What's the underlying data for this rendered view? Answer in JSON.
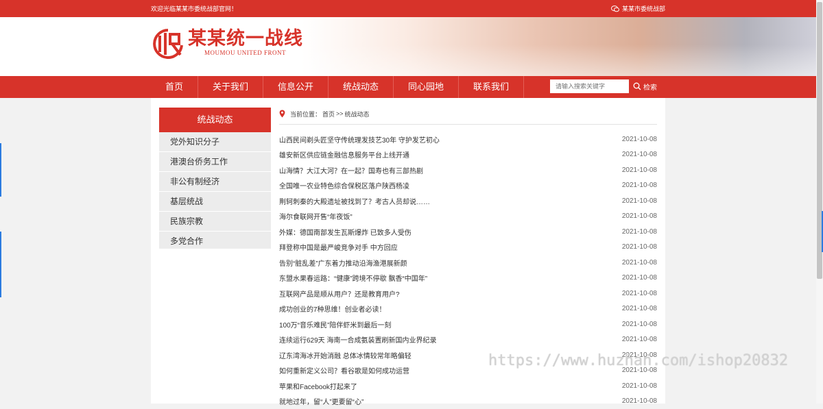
{
  "topbar": {
    "welcome": "欢迎光临某某市委统战部官网！",
    "site_name": "某某市委统战部"
  },
  "logo": {
    "title": "某某统一战线",
    "subtitle": "MOUMOU UNITED FRONT"
  },
  "nav": {
    "items": [
      "首页",
      "关于我们",
      "信息公开",
      "统战动态",
      "同心园地",
      "联系我们"
    ],
    "search_placeholder": "请输入搜索关键字",
    "search_label": "检索"
  },
  "sidebar": {
    "title": "统战动态",
    "items": [
      "党外知识分子",
      "港澳台侨务工作",
      "非公有制经济",
      "基层统战",
      "民族宗教",
      "多党合作"
    ]
  },
  "breadcrumb": {
    "label": "当前位置：",
    "home": "首页",
    "separator": ">>",
    "current": "统战动态"
  },
  "articles": [
    {
      "title": "山西民间剃头匠坚守传统理发技艺30年 守护发艺初心",
      "date": "2021-10-08"
    },
    {
      "title": "雄安新区供应链金融信息服务平台上线开通",
      "date": "2021-10-08"
    },
    {
      "title": "山海情？大江大河？在一起？国寿也有三部热剧",
      "date": "2021-10-08"
    },
    {
      "title": "全国唯一农业特色综合保税区落户陕西杨凌",
      "date": "2021-10-08"
    },
    {
      "title": "荆轲刺秦的大殿遗址被找到了？考古人员却说……",
      "date": "2021-10-08"
    },
    {
      "title": "海尔食联网开售“年夜饭”",
      "date": "2021-10-08"
    },
    {
      "title": "外媒：德国南部发生瓦斯爆炸 已致多人受伤",
      "date": "2021-10-08"
    },
    {
      "title": "拜登称中国是最严峻竞争对手 中方回应",
      "date": "2021-10-08"
    },
    {
      "title": "告别“脏乱差”广东着力推动沿海渔港展新颜",
      "date": "2021-10-08"
    },
    {
      "title": "东盟水果春运路：“健康”跨境不停歇 飘香“中国年”",
      "date": "2021-10-08"
    },
    {
      "title": "互联网产品是顺从用户？还是教育用户?",
      "date": "2021-10-08"
    },
    {
      "title": "成功创业的7种思维！创业者必读！",
      "date": "2021-10-08"
    },
    {
      "title": "100万“音乐难民”陪伴虾米到最后一刻",
      "date": "2021-10-08"
    },
    {
      "title": "连续运行629天 海南一合成氨装置刷新国内业界纪录",
      "date": "2021-10-08"
    },
    {
      "title": "辽东湾海冰开始消融 总体冰情较常年略偏轻",
      "date": "2021-10-08"
    },
    {
      "title": "如何重新定义公司？看谷歌是如何成功运营",
      "date": "2021-10-08"
    },
    {
      "title": "苹果和Facebook打起来了",
      "date": "2021-10-08"
    },
    {
      "title": "就地过年，留“人”更要留“心”",
      "date": "2021-10-08"
    }
  ],
  "watermark": "https://www.huzhan.com/ishop20832",
  "colors": {
    "brand_red": "#d7332a",
    "sidebar_bg": "#ececec"
  }
}
